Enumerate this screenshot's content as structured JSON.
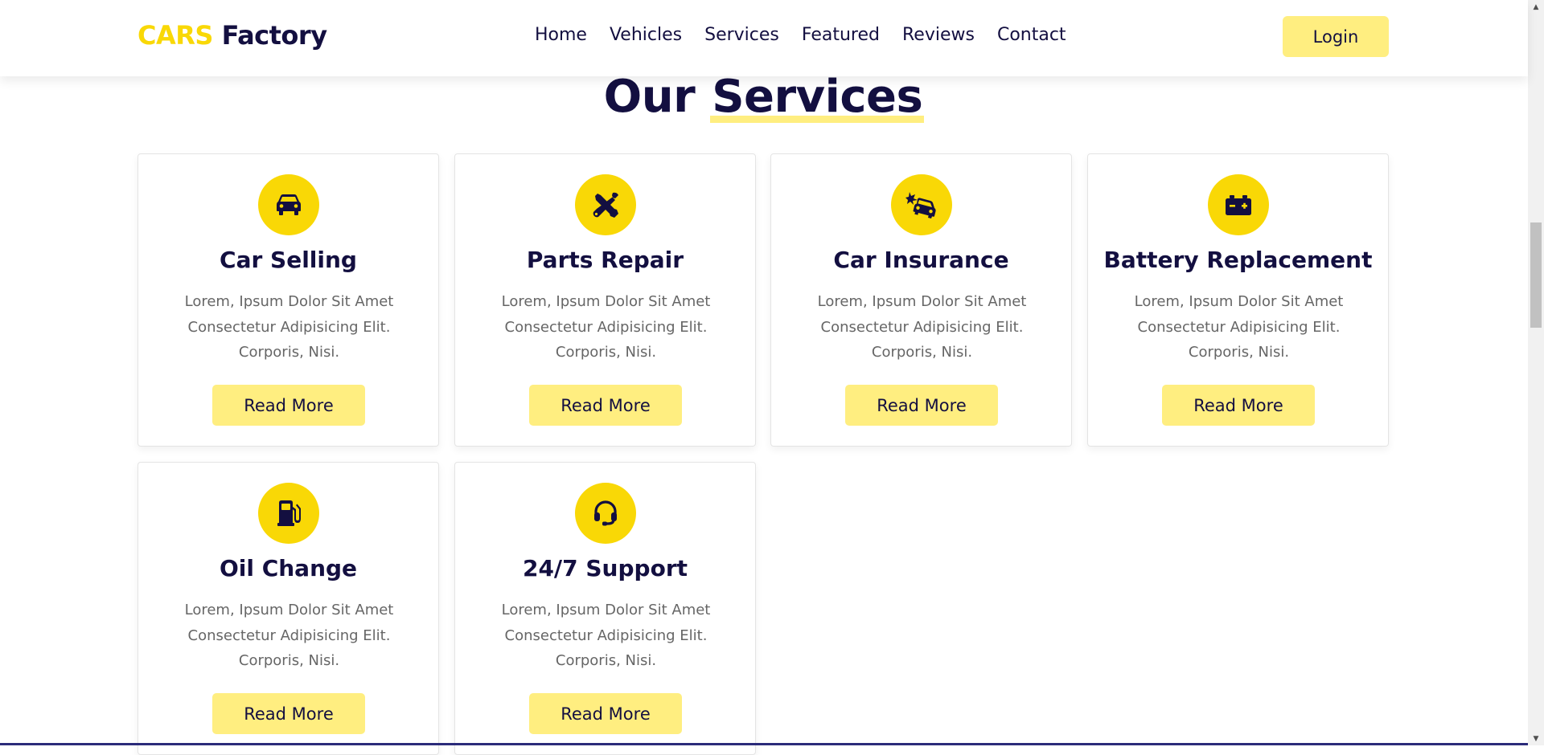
{
  "header": {
    "logo_accent": "CARS",
    "logo_main": "Factory",
    "nav": [
      "Home",
      "Vehicles",
      "Services",
      "Featured",
      "Reviews",
      "Contact"
    ],
    "login_label": "Login"
  },
  "section": {
    "heading_plain": "Our",
    "heading_highlight": "Services"
  },
  "services": [
    {
      "icon": "car-icon",
      "title": "Car Selling",
      "text": "Lorem, Ipsum Dolor Sit Amet Consectetur Adipisicing Elit. Corporis, Nisi.",
      "button": "Read More"
    },
    {
      "icon": "tools-icon",
      "title": "Parts Repair",
      "text": "Lorem, Ipsum Dolor Sit Amet Consectetur Adipisicing Elit. Corporis, Nisi.",
      "button": "Read More"
    },
    {
      "icon": "car-crash-icon",
      "title": "Car Insurance",
      "text": "Lorem, Ipsum Dolor Sit Amet Consectetur Adipisicing Elit. Corporis, Nisi.",
      "button": "Read More"
    },
    {
      "icon": "battery-icon",
      "title": "Battery Replacement",
      "text": "Lorem, Ipsum Dolor Sit Amet Consectetur Adipisicing Elit. Corporis, Nisi.",
      "button": "Read More"
    },
    {
      "icon": "gas-pump-icon",
      "title": "Oil Change",
      "text": "Lorem, Ipsum Dolor Sit Amet Consectetur Adipisicing Elit. Corporis, Nisi.",
      "button": "Read More"
    },
    {
      "icon": "headset-icon",
      "title": "24/7 Support",
      "text": "Lorem, Ipsum Dolor Sit Amet Consectetur Adipisicing Elit. Corporis, Nisi.",
      "button": "Read More"
    }
  ],
  "colors": {
    "accent": "#f9d806",
    "button_bg": "#ffee80",
    "text_dark": "#130f40",
    "text_muted": "#666666"
  }
}
